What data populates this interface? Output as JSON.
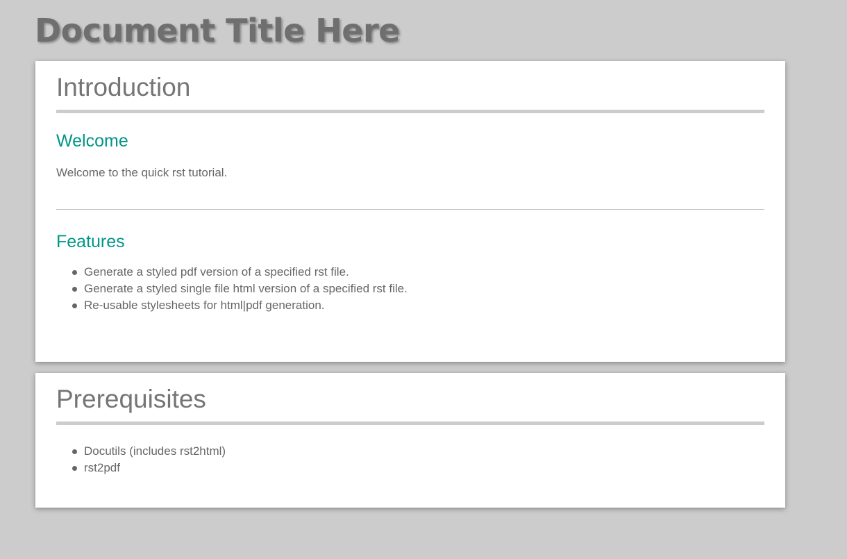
{
  "document": {
    "title": "Document Title Here"
  },
  "sections": {
    "introduction": {
      "title": "Introduction",
      "welcome": {
        "heading": "Welcome",
        "text": "Welcome to the quick rst tutorial."
      },
      "features": {
        "heading": "Features",
        "items": [
          "Generate a styled pdf version of a specified rst file.",
          "Generate a styled single file html version of a specified rst file.",
          "Re-usable stylesheets for html|pdf generation."
        ]
      }
    },
    "prerequisites": {
      "title": "Prerequisites",
      "items": [
        "Docutils (includes rst2html)",
        "rst2pdf"
      ]
    }
  },
  "colors": {
    "background": "#cccccc",
    "card": "#ffffff",
    "accent": "#009688",
    "text": "#666666"
  }
}
